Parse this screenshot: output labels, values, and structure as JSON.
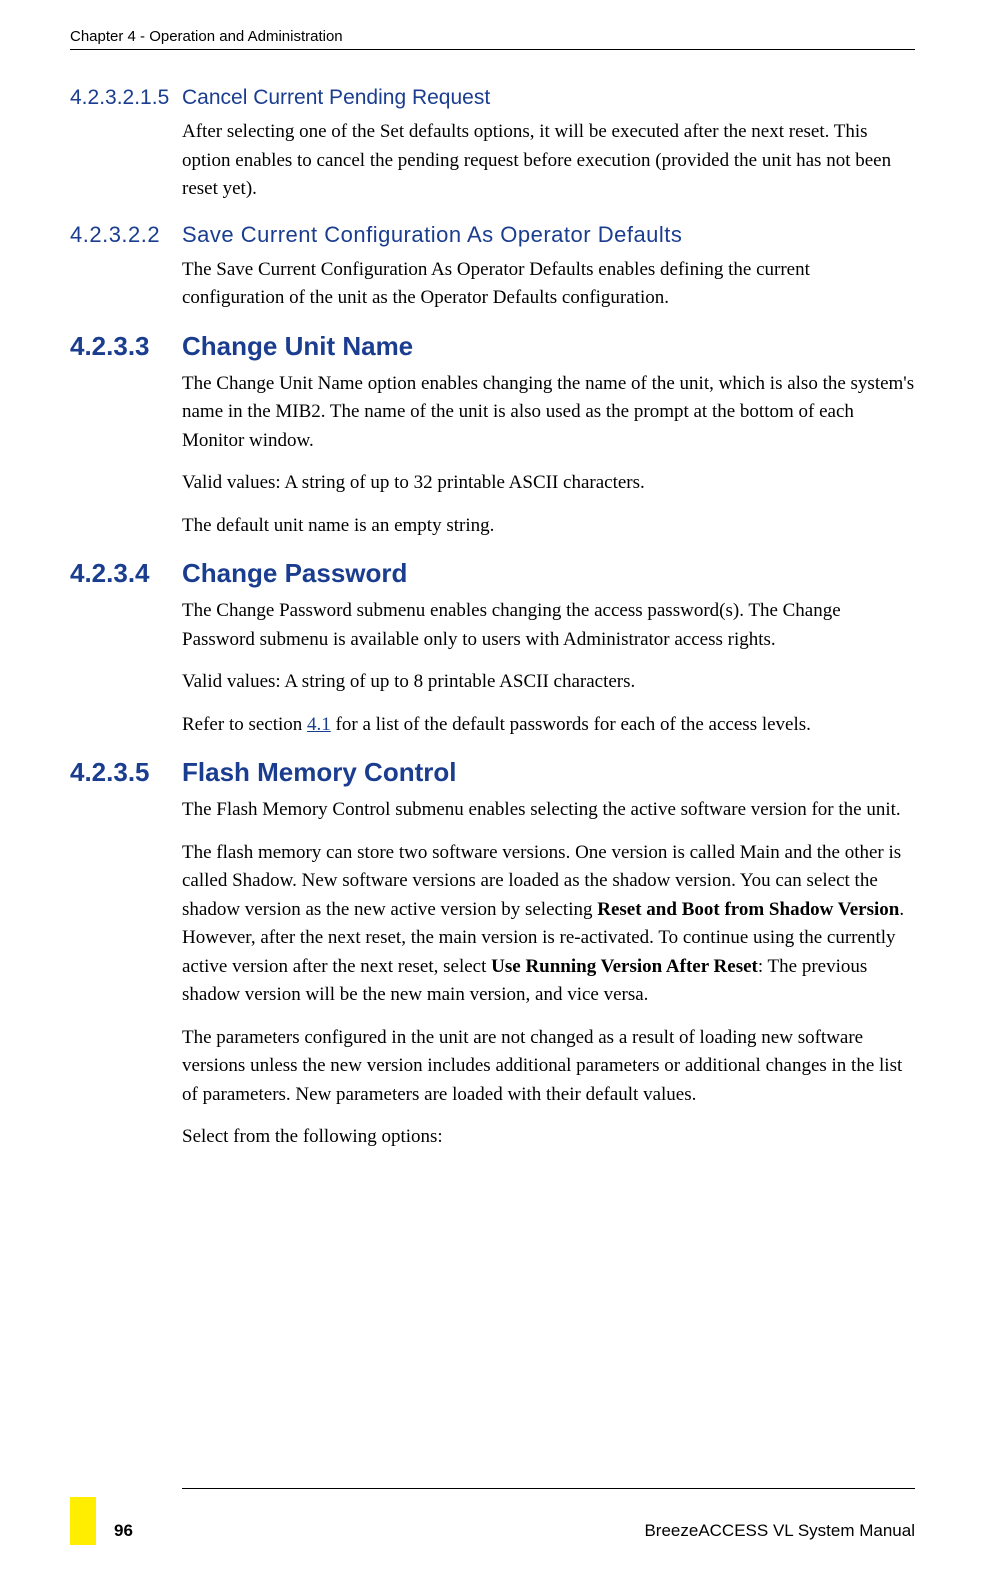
{
  "header": {
    "chapter": "Chapter 4 - Operation and Administration"
  },
  "sections": {
    "s1": {
      "num": "4.2.3.2.1.5",
      "title": "Cancel Current Pending Request",
      "p1": "After selecting one of the Set defaults options, it will be executed after the next reset. This option enables to cancel the pending request before execution (provided the unit has not been reset yet)."
    },
    "s2": {
      "num": "4.2.3.2.2",
      "title": "Save Current Configuration As Operator Defaults",
      "p1": "The Save Current Configuration As Operator Defaults enables defining the current configuration of the unit as the Operator Defaults configuration."
    },
    "s3": {
      "num": "4.2.3.3",
      "title": "Change Unit Name",
      "p1": "The Change Unit Name option enables changing the name of the unit, which is also the system's name in the MIB2. The name of the unit is also used as the prompt at the bottom of each Monitor window.",
      "p2": "Valid values: A string of up to 32 printable ASCII characters.",
      "p3": "The default unit name is an empty string."
    },
    "s4": {
      "num": "4.2.3.4",
      "title": "Change Password",
      "p1": "The Change Password submenu enables changing the access password(s). The Change Password submenu is available only to users with Administrator access rights.",
      "p2": "Valid values: A string of up to 8 printable ASCII characters.",
      "p3_pre": "Refer to section ",
      "p3_link": "4.1",
      "p3_post": " for a list of the default passwords for each of the access levels."
    },
    "s5": {
      "num": "4.2.3.5",
      "title": "Flash Memory Control",
      "p1": "The Flash Memory Control submenu enables selecting the active software version for the unit.",
      "p2_pre": "The flash memory can store two software versions. One version is called Main and the other is called Shadow. New software versions are loaded as the shadow version. You can select the shadow version as the new active version by selecting ",
      "p2_b1": "Reset and Boot from Shadow Version",
      "p2_mid": ". However, after the next reset, the main version is re-activated. To continue using the currently active version after the next reset, select ",
      "p2_b2": "Use Running Version After Reset",
      "p2_post": ": The previous shadow version will be the new main version, and vice versa.",
      "p3": "The parameters configured in the unit are not changed as a result of loading new software versions unless the new version includes additional parameters or additional changes in the list of parameters. New parameters are loaded with their default values.",
      "p4": "Select from the following options:"
    }
  },
  "footer": {
    "page": "96",
    "manual": "BreezeACCESS VL System Manual"
  }
}
